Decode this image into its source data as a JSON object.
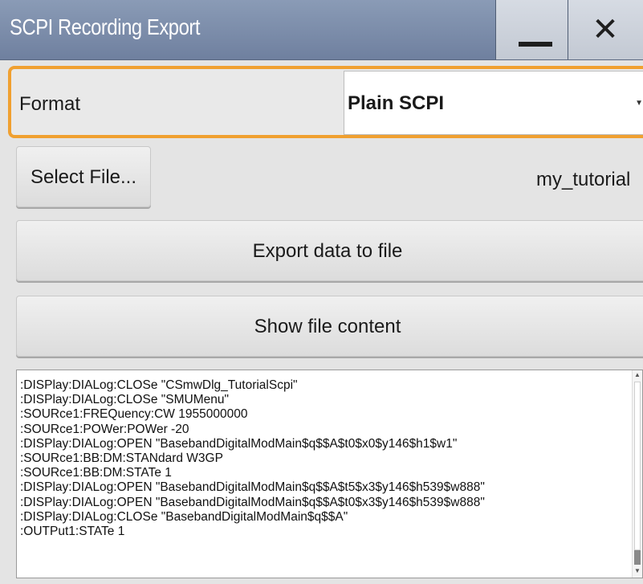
{
  "window": {
    "title": "SCPI Recording Export",
    "minimize_icon": "minimize-icon",
    "close_icon": "close-icon",
    "close_glyph": "✕"
  },
  "format": {
    "label": "Format",
    "selected": "Plain SCPI"
  },
  "file": {
    "select_label": "Select File...",
    "filename": "my_tutorial"
  },
  "actions": {
    "export_label": "Export data to file",
    "show_label": "Show file content"
  },
  "file_content": {
    "lines": [
      ":DISPlay:DIALog:CLOSe \"CSmwDlg_TutorialScpi\"",
      ":DISPlay:DIALog:CLOSe \"SMUMenu\"",
      ":SOURce1:FREQuency:CW 1955000000",
      ":SOURce1:POWer:POWer -20",
      ":DISPlay:DIALog:OPEN \"BasebandDigitalModMain$q$$A$t0$x0$y146$h1$w1\"",
      ":SOURce1:BB:DM:STANdard W3GP",
      ":SOURce1:BB:DM:STATe 1",
      ":DISPlay:DIALog:OPEN \"BasebandDigitalModMain$q$$A$t5$x3$y146$h539$w888\"",
      ":DISPlay:DIALog:OPEN \"BasebandDigitalModMain$q$$A$t0$x3$y146$h539$w888\"",
      ":DISPlay:DIALog:CLOSe \"BasebandDigitalModMain$q$$A\"",
      ":OUTPut1:STATe 1"
    ]
  },
  "colors": {
    "titlebar": "#7a8ba8",
    "focus_border": "#f0a030"
  }
}
